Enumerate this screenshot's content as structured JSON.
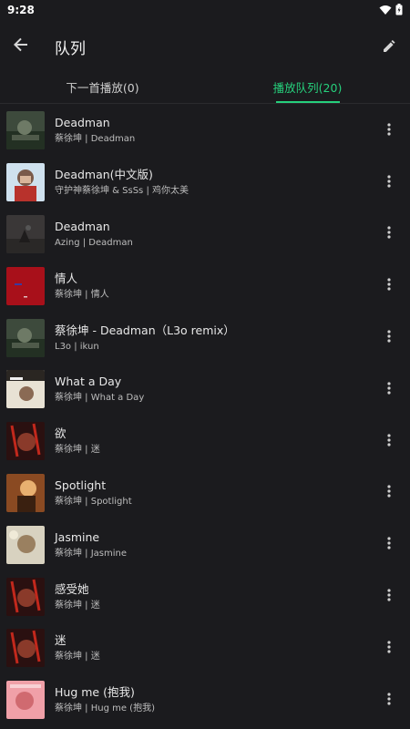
{
  "status": {
    "time": "9:28"
  },
  "header": {
    "title": "队列"
  },
  "tabs": [
    {
      "label": "下一首播放(0)"
    },
    {
      "label": "播放队列(20)"
    }
  ],
  "songs": [
    {
      "title": "Deadman",
      "subtitle": "蔡徐坤 | Deadman"
    },
    {
      "title": "Deadman(中文版)",
      "subtitle": "守护神蔡徐坤 & SsSs | 鸡你太美"
    },
    {
      "title": "Deadman",
      "subtitle": "Azing | Deadman"
    },
    {
      "title": "情人",
      "subtitle": "蔡徐坤 | 情人"
    },
    {
      "title": "蔡徐坤 - Deadman（L3o remix）",
      "subtitle": "L3o | ikun"
    },
    {
      "title": "What a Day",
      "subtitle": "蔡徐坤 | What a Day"
    },
    {
      "title": "欲",
      "subtitle": "蔡徐坤 | 迷"
    },
    {
      "title": "Spotlight",
      "subtitle": "蔡徐坤 | Spotlight"
    },
    {
      "title": "Jasmine",
      "subtitle": "蔡徐坤 | Jasmine"
    },
    {
      "title": "感受她",
      "subtitle": "蔡徐坤 | 迷"
    },
    {
      "title": "迷",
      "subtitle": "蔡徐坤 | 迷"
    },
    {
      "title": "Hug me (抱我)",
      "subtitle": "蔡徐坤 | Hug me (抱我)"
    }
  ],
  "colors": {
    "accent": "#26d07c",
    "background": "#1b1b1e"
  }
}
